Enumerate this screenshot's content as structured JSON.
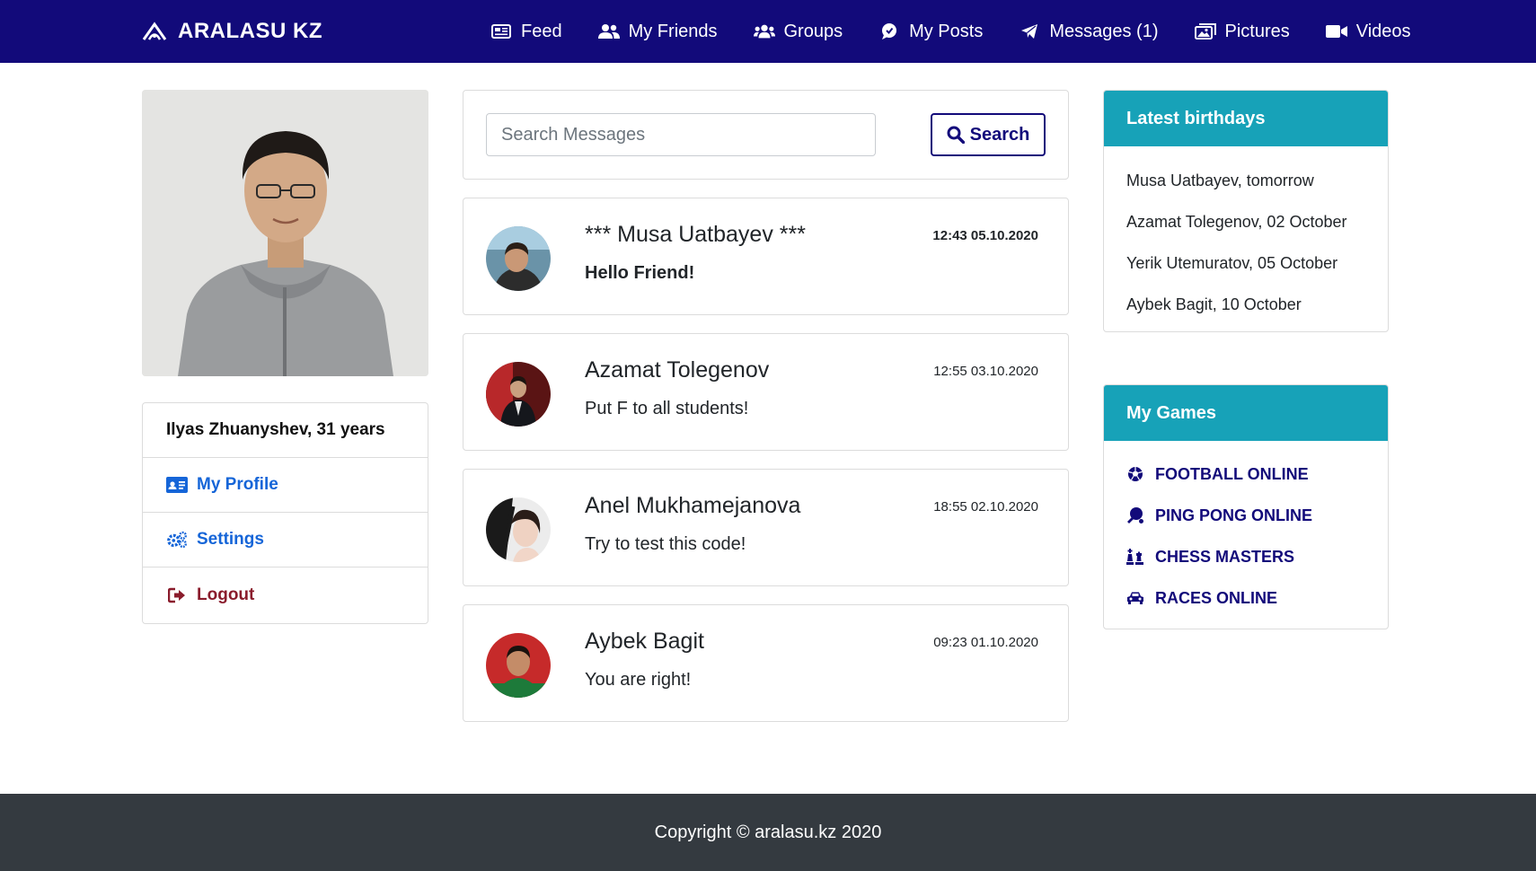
{
  "brand": {
    "name": "ARALASU KZ",
    "icon": "aralasu-logo-icon"
  },
  "nav": {
    "items": [
      {
        "label": "Feed",
        "icon": "newspaper-icon"
      },
      {
        "label": "My Friends",
        "icon": "user-friends-icon"
      },
      {
        "label": "Groups",
        "icon": "users-icon"
      },
      {
        "label": "My Posts",
        "icon": "comment-icon"
      },
      {
        "label": "Messages (1)",
        "icon": "paper-plane-icon"
      },
      {
        "label": "Pictures",
        "icon": "images-icon"
      },
      {
        "label": "Videos",
        "icon": "video-icon"
      }
    ]
  },
  "profile": {
    "name_age": "Ilyas Zhuanyshev, 31 years",
    "links": [
      {
        "label": "My Profile",
        "icon": "id-card-icon"
      },
      {
        "label": "Settings",
        "icon": "cogs-icon"
      },
      {
        "label": "Logout",
        "icon": "sign-out-icon"
      }
    ]
  },
  "search": {
    "placeholder": "Search Messages",
    "button_label": "Search"
  },
  "messages": [
    {
      "name": "*** Musa Uatbayev ***",
      "text": "Hello Friend!",
      "time": "12:43 05.10.2020",
      "unread": true
    },
    {
      "name": "Azamat Tolegenov",
      "text": "Put F to all students!",
      "time": "12:55 03.10.2020",
      "unread": false
    },
    {
      "name": "Anel Mukhamejanova",
      "text": "Try to test this code!",
      "time": "18:55 02.10.2020",
      "unread": false
    },
    {
      "name": "Aybek Bagit",
      "text": "You are right!",
      "time": "09:23 01.10.2020",
      "unread": false
    }
  ],
  "birthdays": {
    "title": "Latest birthdays",
    "items": [
      "Musa Uatbayev, tomorrow",
      "Azamat Tolegenov, 02 October",
      "Yerik Utemuratov, 05 October",
      "Aybek Bagit, 10 October"
    ]
  },
  "games": {
    "title": "My Games",
    "items": [
      {
        "label": "FOOTBALL ONLINE",
        "icon": "futbol-icon"
      },
      {
        "label": "PING PONG ONLINE",
        "icon": "table-tennis-icon"
      },
      {
        "label": "CHESS MASTERS",
        "icon": "chess-icon"
      },
      {
        "label": "RACES ONLINE",
        "icon": "car-icon"
      }
    ]
  },
  "footer": {
    "text": "Copyright © aralasu.kz 2020"
  },
  "colors": {
    "navbar": "#120a7a",
    "accent_teal": "#17a2b8",
    "link_blue": "#1565d8",
    "logout_red": "#8a1c2c",
    "footer": "#343a40"
  }
}
